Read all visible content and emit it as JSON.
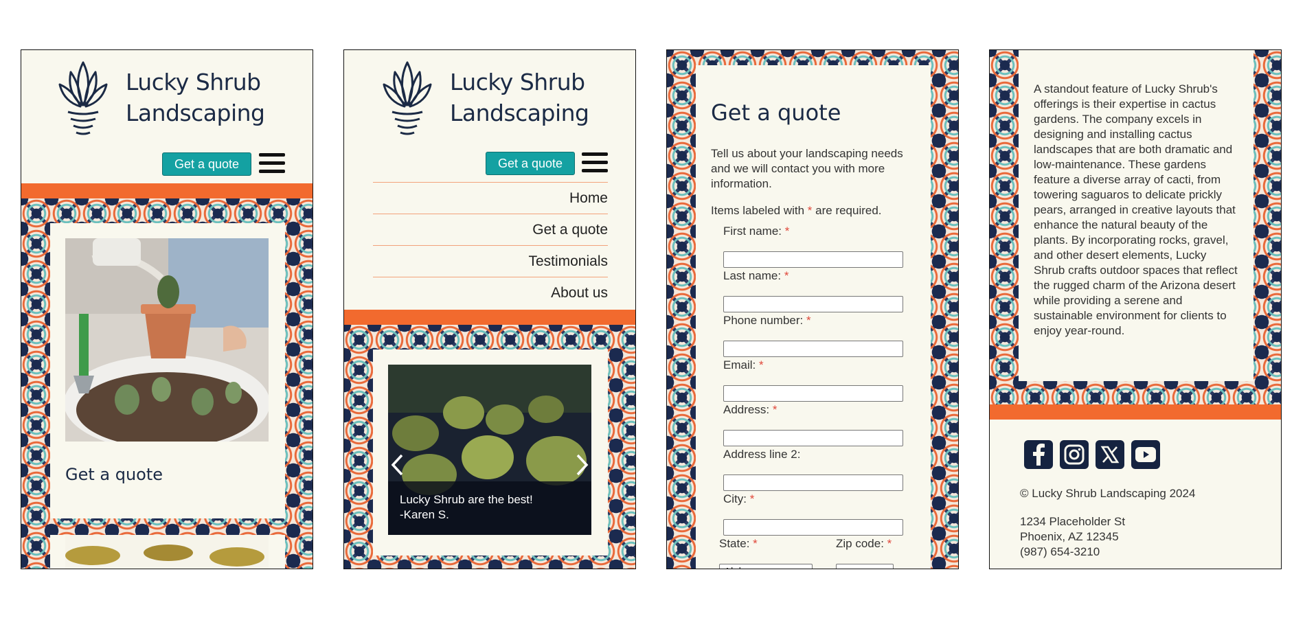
{
  "brand": {
    "name_line1": "Lucky Shrub",
    "name_line2": "Landscaping"
  },
  "header": {
    "quote_button": "Get a quote",
    "menu_icon": "hamburger-icon"
  },
  "nav": {
    "items": [
      "Home",
      "Get a quote",
      "Testimonials",
      "About us"
    ]
  },
  "screen1": {
    "card_title": "Get a quote"
  },
  "screen2": {
    "testimonial_line1": "Lucky Shrub are the best!",
    "testimonial_line2": "-Karen S.",
    "prev_icon": "chevron-left-icon",
    "next_icon": "chevron-right-icon"
  },
  "form": {
    "title": "Get a quote",
    "intro": "Tell us about your landscaping needs and we will contact you with more information.",
    "required_prefix": "Items labeled with ",
    "required_marker": "*",
    "required_suffix": " are required.",
    "first_name": "First name:",
    "last_name": "Last name:",
    "phone": "Phone number:",
    "email": "Email:",
    "address": "Address:",
    "address2": "Address line 2:",
    "city": "City:",
    "state": "State:",
    "zip": "Zip code:",
    "state_value": "Alabama"
  },
  "about": {
    "paragraph": "A standout feature of Lucky Shrub's offerings is their expertise in cactus gardens. The company excels in designing and installing cactus landscapes that are both dramatic and low-maintenance. These gardens feature a diverse array of cacti, from towering saguaros to delicate prickly pears, arranged in creative layouts that enhance the natural beauty of the plants. By incorporating rocks, gravel, and other desert elements, Lucky Shrub crafts outdoor spaces that reflect the rugged charm of the Arizona desert while providing a serene and sustainable environment for clients to enjoy year-round."
  },
  "footer": {
    "social": [
      "facebook-icon",
      "instagram-icon",
      "x-icon",
      "youtube-icon"
    ],
    "copyright": "© Lucky Shrub Landscaping 2024",
    "address1": "1234 Placeholder St",
    "address2": "Phoenix, AZ 12345",
    "phone": "(987) 654-3210"
  },
  "colors": {
    "navy": "#1b2a45",
    "teal": "#14a1a2",
    "orange": "#f26a2e",
    "cream": "#f9f8ee"
  }
}
